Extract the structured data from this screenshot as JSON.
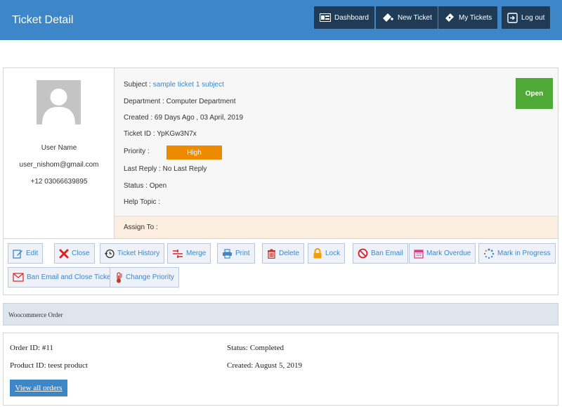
{
  "header": {
    "title": "Ticket Detail",
    "nav": {
      "dashboard": "Dashboard",
      "new_ticket": "New Ticket",
      "my_tickets": "My Tickets",
      "logout": "Log out"
    }
  },
  "user": {
    "name": "User Name",
    "email": "user_nishom@gmail.com",
    "phone": "+12 03066639895"
  },
  "ticket": {
    "subject_label": "Subject :",
    "subject_value": "sample ticket 1 subject",
    "department_label": "Department :",
    "department_value": "Computer Department",
    "created_label": "Created :",
    "created_value": "69 Days Ago , 03 April, 2019",
    "id_label": "Ticket ID :",
    "id_value": "YpKGw3N7x",
    "priority_label": "Priority :",
    "priority_value": "High",
    "last_reply_label": "Last Reply :",
    "last_reply_value": "No Last Reply",
    "status_label": "Status :",
    "status_value": "Open",
    "help_topic_label": "Help Topic :",
    "help_topic_value": "",
    "assign_label": "Assign To :",
    "status_badge": "Open"
  },
  "actions": {
    "edit": "Edit",
    "close": "Close",
    "history": "Ticket History",
    "merge": "Merge",
    "print": "Print",
    "delete": "Delete",
    "lock": "Lock",
    "ban_email": "Ban Email",
    "mark_overdue": "Mark Overdue",
    "mark_in_progress": "Mark in Progress",
    "ban_close": "Ban Email and Close Ticket",
    "change_priority": "Change Priority"
  },
  "woocommerce": {
    "heading": "Woocommerce Order",
    "order_id_label": "Order ID:",
    "order_id_value": "#11",
    "product_id_label": "Product ID:",
    "product_id_value": "teest product",
    "status_label": "Status:",
    "status_value": "Completed",
    "created_label": "Created:",
    "created_value": "August 5, 2019",
    "view_all": "View all orders"
  },
  "colors": {
    "header_bg": "#3d87c8",
    "header_button_bg": "#1f3b56",
    "priority_high": "#ee8a00",
    "status_open": "#4fa936",
    "close_icon": "#e02020",
    "lock_icon": "#f0a000",
    "pink_icon": "#e03a8c"
  },
  "icons": [
    "dashboard-icon",
    "new-ticket-icon",
    "my-tickets-icon",
    "logout-icon",
    "edit-icon",
    "close-icon",
    "history-icon",
    "merge-icon",
    "print-icon",
    "delete-icon",
    "lock-icon",
    "ban-icon",
    "calendar-icon",
    "spinner-icon",
    "mail-icon",
    "thermometer-icon"
  ]
}
